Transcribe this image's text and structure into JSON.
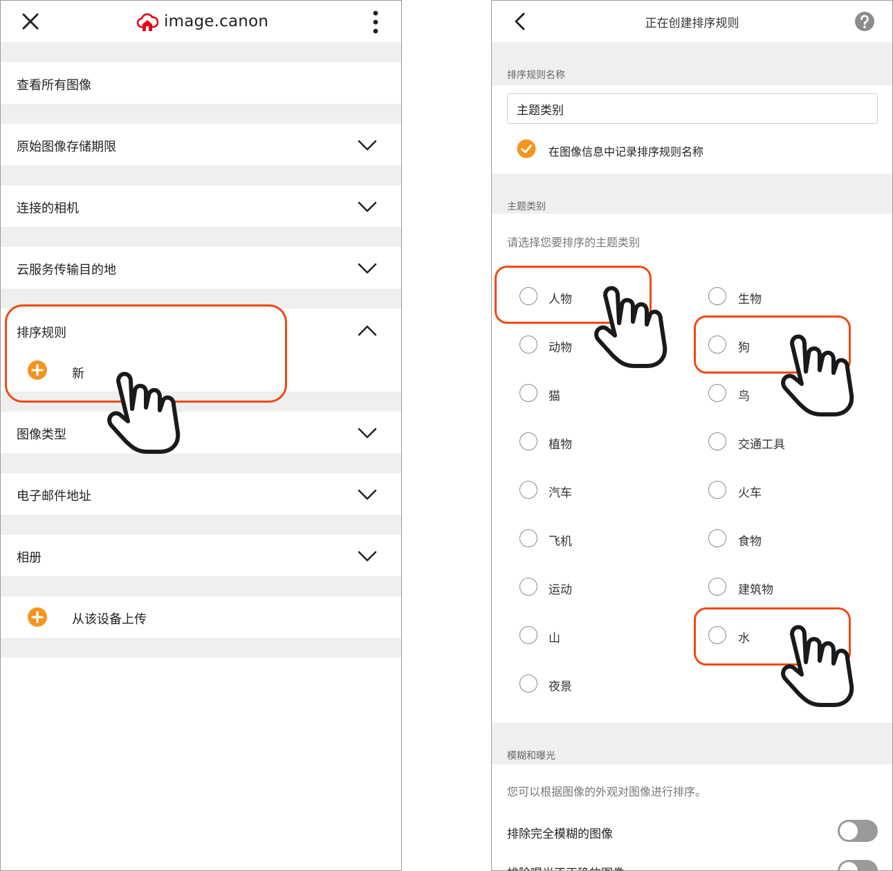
{
  "left": {
    "header": {
      "brand": "image.canon",
      "close_icon": "close-icon",
      "menu_icon": "more-vertical-icon"
    },
    "menu": [
      {
        "label": "查看所有图像",
        "chevron": "none"
      },
      {
        "label": "原始图像存储期限",
        "chevron": "down"
      },
      {
        "label": "连接的相机",
        "chevron": "down"
      },
      {
        "label": "云服务传输目的地",
        "chevron": "down"
      },
      {
        "label": "排序规则",
        "chevron": "up"
      },
      {
        "label": "图像类型",
        "chevron": "down"
      },
      {
        "label": "电子邮件地址",
        "chevron": "down"
      },
      {
        "label": "相册",
        "chevron": "down"
      }
    ],
    "sort_new_label": "新",
    "upload_label": "从该设备上传"
  },
  "right": {
    "header": {
      "title": "正在创建排序规则",
      "back_icon": "chevron-left-icon",
      "help_icon": "help-icon"
    },
    "name_section": {
      "heading": "排序规则名称",
      "input_value": "主题类别",
      "checkbox_label": "在图像信息中记录排序规则名称",
      "checkbox_checked": true
    },
    "subject_section": {
      "heading": "主题类别",
      "hint": "请选择您要排序的主题类别",
      "options_left": [
        "人物",
        "动物",
        "猫",
        "植物",
        "汽车",
        "飞机",
        "运动",
        "山",
        "夜景"
      ],
      "options_right": [
        "生物",
        "狗",
        "鸟",
        "交通工具",
        "火车",
        "食物",
        "建筑物",
        "水"
      ]
    },
    "blur_section": {
      "heading": "模糊和曝光",
      "hint": "您可以根据图像的外观对图像进行排序。",
      "toggle_1_label": "排除完全模糊的图像",
      "toggle_2_label": "排除曝光不正确的图像"
    }
  },
  "colors": {
    "accent": "#ee4a10",
    "orange": "#f7941d",
    "logo_red": "#e60012",
    "divider": "#efefef",
    "toggle_off": "#9a9a9a"
  }
}
